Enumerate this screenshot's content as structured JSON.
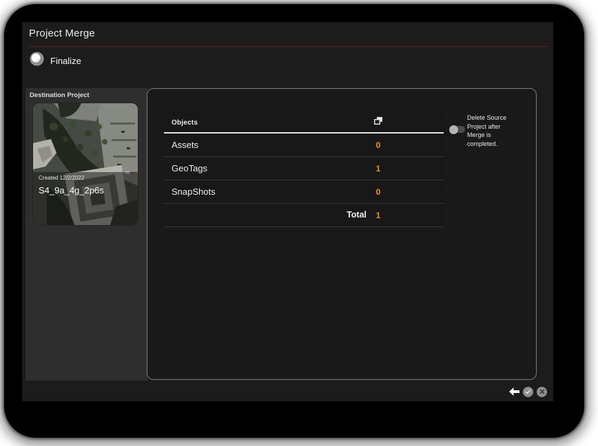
{
  "window": {
    "title": "Project Merge"
  },
  "wizard": {
    "step_label": "Finalize"
  },
  "sidebar": {
    "heading": "Destination Project",
    "project": {
      "created_label": "Created 12/2/2022",
      "name": "S4_9a_4g_2p6s"
    }
  },
  "merge_table": {
    "column_header": "Objects",
    "header_icon": "copy-objects-icon",
    "rows": [
      {
        "label": "Assets",
        "count": "0"
      },
      {
        "label": "GeoTags",
        "count": "1"
      },
      {
        "label": "SnapShots",
        "count": "0"
      }
    ],
    "total": {
      "label": "Total",
      "count": "1"
    }
  },
  "options": {
    "delete_source": {
      "label": "Delete Source Project after Merge is completed.",
      "enabled": false
    }
  },
  "footer": {
    "back_icon": "back-arrow-icon",
    "confirm_icon": "confirm-check-icon",
    "cancel_icon": "cancel-x-icon"
  },
  "colors": {
    "count_accent": "#EF9420",
    "header_divider_red": "#6E1B1B",
    "window_bg": "#1C1C1C",
    "sidebar_bg": "#2E2E2E"
  }
}
